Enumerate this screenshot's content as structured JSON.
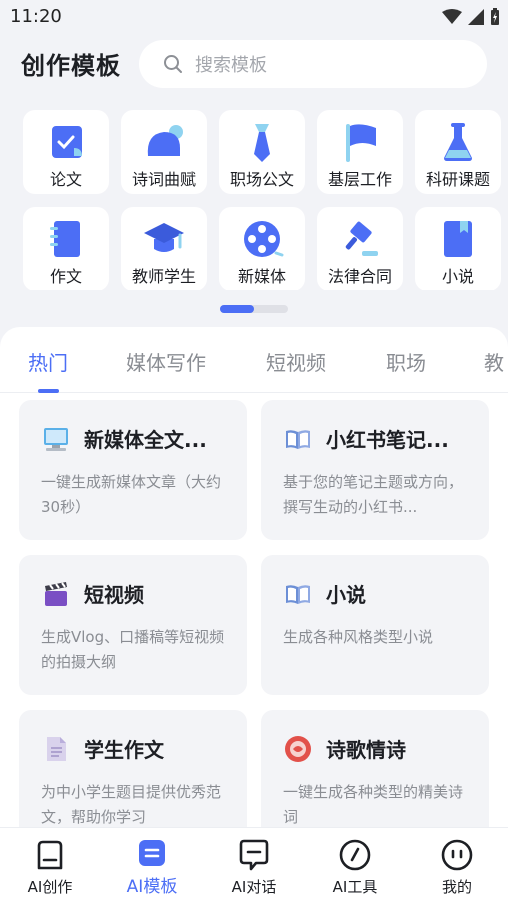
{
  "status_bar": {
    "time": "11:20"
  },
  "header": {
    "title": "创作模板",
    "search_placeholder": "搜索模板"
  },
  "categories": [
    {
      "label": "论文",
      "icon": "paper-check-icon"
    },
    {
      "label": "诗词曲赋",
      "icon": "chat-bubble-icon"
    },
    {
      "label": "职场公文",
      "icon": "necktie-icon"
    },
    {
      "label": "基层工作",
      "icon": "flag-icon"
    },
    {
      "label": "科研课题",
      "icon": "flask-icon"
    },
    {
      "label": "作文",
      "icon": "notebook-icon"
    },
    {
      "label": "教师学生",
      "icon": "graduation-cap-icon"
    },
    {
      "label": "新媒体",
      "icon": "film-reel-icon"
    },
    {
      "label": "法律合同",
      "icon": "gavel-icon"
    },
    {
      "label": "小说",
      "icon": "book-icon"
    }
  ],
  "pager": {
    "active_index": 0
  },
  "tabs": [
    {
      "label": "热门",
      "active": true
    },
    {
      "label": "媒体写作"
    },
    {
      "label": "短视频"
    },
    {
      "label": "职场"
    },
    {
      "label": "教"
    }
  ],
  "cards": [
    {
      "title": "新媒体全文...",
      "desc": "一键生成新媒体文章（大约30秒）",
      "icon": "computer-icon"
    },
    {
      "title": "小红书笔记...",
      "desc": "基于您的笔记主题或方向，撰写生动的小红书...",
      "icon": "open-book-icon"
    },
    {
      "title": "短视频",
      "desc": "生成Vlog、口播稿等短视频的拍摄大纲",
      "icon": "clapperboard-icon"
    },
    {
      "title": "小说",
      "desc": "生成各种风格类型小说",
      "icon": "open-book-icon"
    },
    {
      "title": "学生作文",
      "desc": "为中小学生题目提供优秀范文，帮助你学习",
      "icon": "document-icon"
    },
    {
      "title": "诗歌情诗",
      "desc": "一键生成各种类型的精美诗词",
      "icon": "red-seal-icon"
    }
  ],
  "bottom_nav": [
    {
      "label": "AI创作",
      "icon": "create-icon"
    },
    {
      "label": "AI模板",
      "icon": "template-icon",
      "active": true
    },
    {
      "label": "AI对话",
      "icon": "chat-icon"
    },
    {
      "label": "AI工具",
      "icon": "compass-icon"
    },
    {
      "label": "我的",
      "icon": "profile-face-icon"
    }
  ],
  "colors": {
    "accent": "#4c6ef5",
    "background": "#f2f3f7",
    "card": "#f3f4f7"
  }
}
